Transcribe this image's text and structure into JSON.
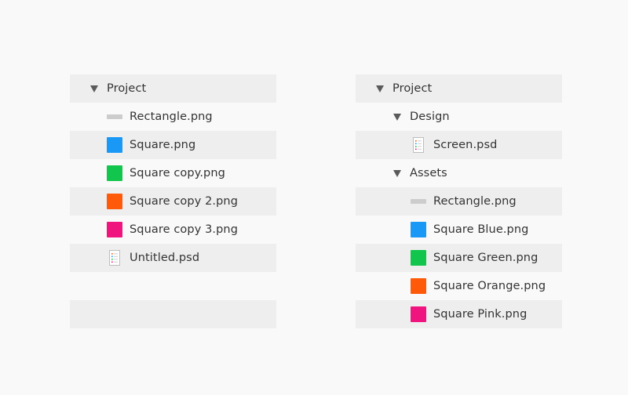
{
  "colors": {
    "background": "#f9f9f9",
    "row_shade": "#eeeeee",
    "caret": "#5a5a5a",
    "rectangle": "#cccccc",
    "blue": "#1a98f5",
    "green": "#12c54c",
    "orange": "#ff5a0a",
    "pink": "#f0147f"
  },
  "left_tree": {
    "root": {
      "label": "Project",
      "icon": "caret-down-icon"
    },
    "items": [
      {
        "label": "Rectangle.png",
        "icon": "rectangle-icon"
      },
      {
        "label": "Square.png",
        "icon": "blue-square-icon"
      },
      {
        "label": "Square copy.png",
        "icon": "green-square-icon"
      },
      {
        "label": "Square copy 2.png",
        "icon": "orange-square-icon"
      },
      {
        "label": "Square copy 3.png",
        "icon": "pink-square-icon"
      },
      {
        "label": "Untitled.psd",
        "icon": "psd-document-icon"
      }
    ]
  },
  "right_tree": {
    "root": {
      "label": "Project",
      "icon": "caret-down-icon"
    },
    "design": {
      "label": "Design",
      "icon": "caret-down-icon",
      "items": [
        {
          "label": "Screen.psd",
          "icon": "psd-document-icon"
        }
      ]
    },
    "assets": {
      "label": "Assets",
      "icon": "caret-down-icon",
      "items": [
        {
          "label": "Rectangle.png",
          "icon": "rectangle-icon"
        },
        {
          "label": "Square Blue.png",
          "icon": "blue-square-icon"
        },
        {
          "label": "Square Green.png",
          "icon": "green-square-icon"
        },
        {
          "label": "Square Orange.png",
          "icon": "orange-square-icon"
        },
        {
          "label": "Square Pink.png",
          "icon": "pink-square-icon"
        }
      ]
    }
  }
}
